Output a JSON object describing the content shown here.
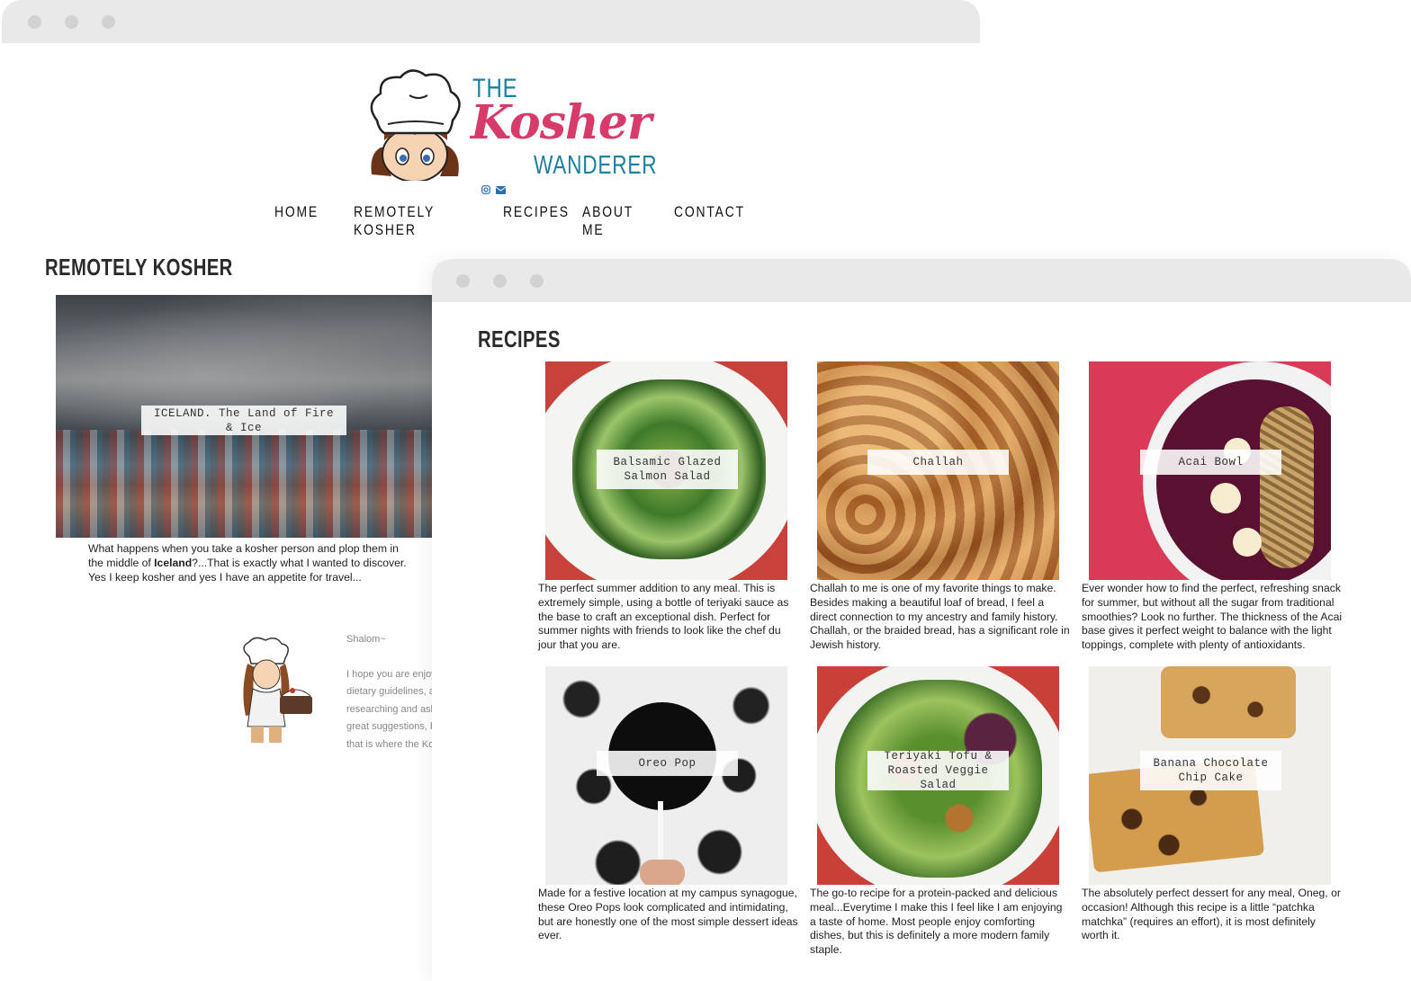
{
  "logo": {
    "line1": "THE",
    "line2": "Kosher",
    "line3": "WANDERER"
  },
  "social": {
    "instagram_icon": "instagram-icon",
    "email_icon": "envelope-icon"
  },
  "nav": [
    "HOME",
    "REMOTELY KOSHER",
    "RECIPES",
    "ABOUT ME",
    "CONTACT"
  ],
  "remotely": {
    "title": "REMOTELY KOSHER",
    "card_label": "ICELAND. The Land of Fire & Ice",
    "text_1": "What happens when you take a kosher person and plop them in the middle of ",
    "text_bold": "Iceland",
    "text_2": "?...That is exactly what I wanted to discover. Yes I keep kosher and yes I have an appetite for travel..."
  },
  "about": {
    "greeting": "Shalom~",
    "lines": [
      "I hope you are enjoy",
      "dietary guidelines, a",
      "researching and ask",
      "great suggestions, b",
      "that is where the Ko"
    ]
  },
  "recipes": {
    "title": "RECIPES",
    "items": [
      {
        "label": "Balsamic Glazed Salmon Salad",
        "text": "The perfect summer addition to any meal. This is extremely simple, using a bottle of teriyaki sauce as the base to craft an exceptional dish. Perfect for summer nights with friends to look like the chef du jour that you are."
      },
      {
        "label": "Challah",
        "text": "Challah to me is one of my favorite things to make. Besides making a beautiful loaf of bread, I feel a direct connection to my ancestry and family history. Challah, or the braided bread, has a significant role in Jewish history."
      },
      {
        "label": "Acai Bowl",
        "text": "Ever wonder how to find the perfect, refreshing snack for summer, but without all the sugar from traditional smoothies? Look no further. The thickness of the Acai base gives it perfect weight to balance with the light toppings, complete with plenty of antioxidants."
      },
      {
        "label": "Oreo Pop",
        "text": "Made for a festive location at my campus synagogue, these Oreo Pops look complicated and intimidating, but are honestly one of the most simple dessert ideas ever."
      },
      {
        "label": "Teriyaki Tofu & Roasted Veggie Salad",
        "text": "The go-to recipe for a protein-packed and delicious meal...Everytime I make this I feel like I am enjoying a taste of home. Most people enjoy comforting dishes, but this is definitely a more modern family staple."
      },
      {
        "label": "Banana Chocolate Chip Cake",
        "text": "The absolutely perfect dessert for any meal, Oneg, or occasion! Although this recipe is a little “patchka matchka” (requires an effort), it is most definitely worth it."
      }
    ]
  }
}
